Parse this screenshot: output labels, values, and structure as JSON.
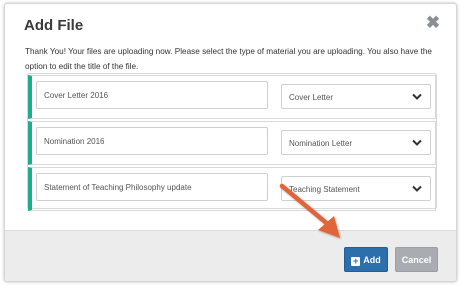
{
  "dialog": {
    "title": "Add File",
    "intro": "Thank You! Your files are uploading now. Please select the type of material you are uploading. You also have the option to edit the title of the file."
  },
  "files": [
    {
      "title": "Cover Letter 2016",
      "type": "Cover Letter"
    },
    {
      "title": "Nomination 2016",
      "type": "Nomination Letter"
    },
    {
      "title": "Statement of Teaching Philosophy update",
      "type": "Teaching Statement"
    }
  ],
  "footer": {
    "add_label": "Add",
    "cancel_label": "Cancel"
  },
  "colors": {
    "accent": "#1cae8c",
    "primary": "#2b6fad",
    "secondary": "#a9adb1",
    "annotation_arrow": "#e0653a"
  },
  "icons": {
    "close": "close-icon",
    "add": "plus-square-icon",
    "select": "chevron-down-icon"
  }
}
